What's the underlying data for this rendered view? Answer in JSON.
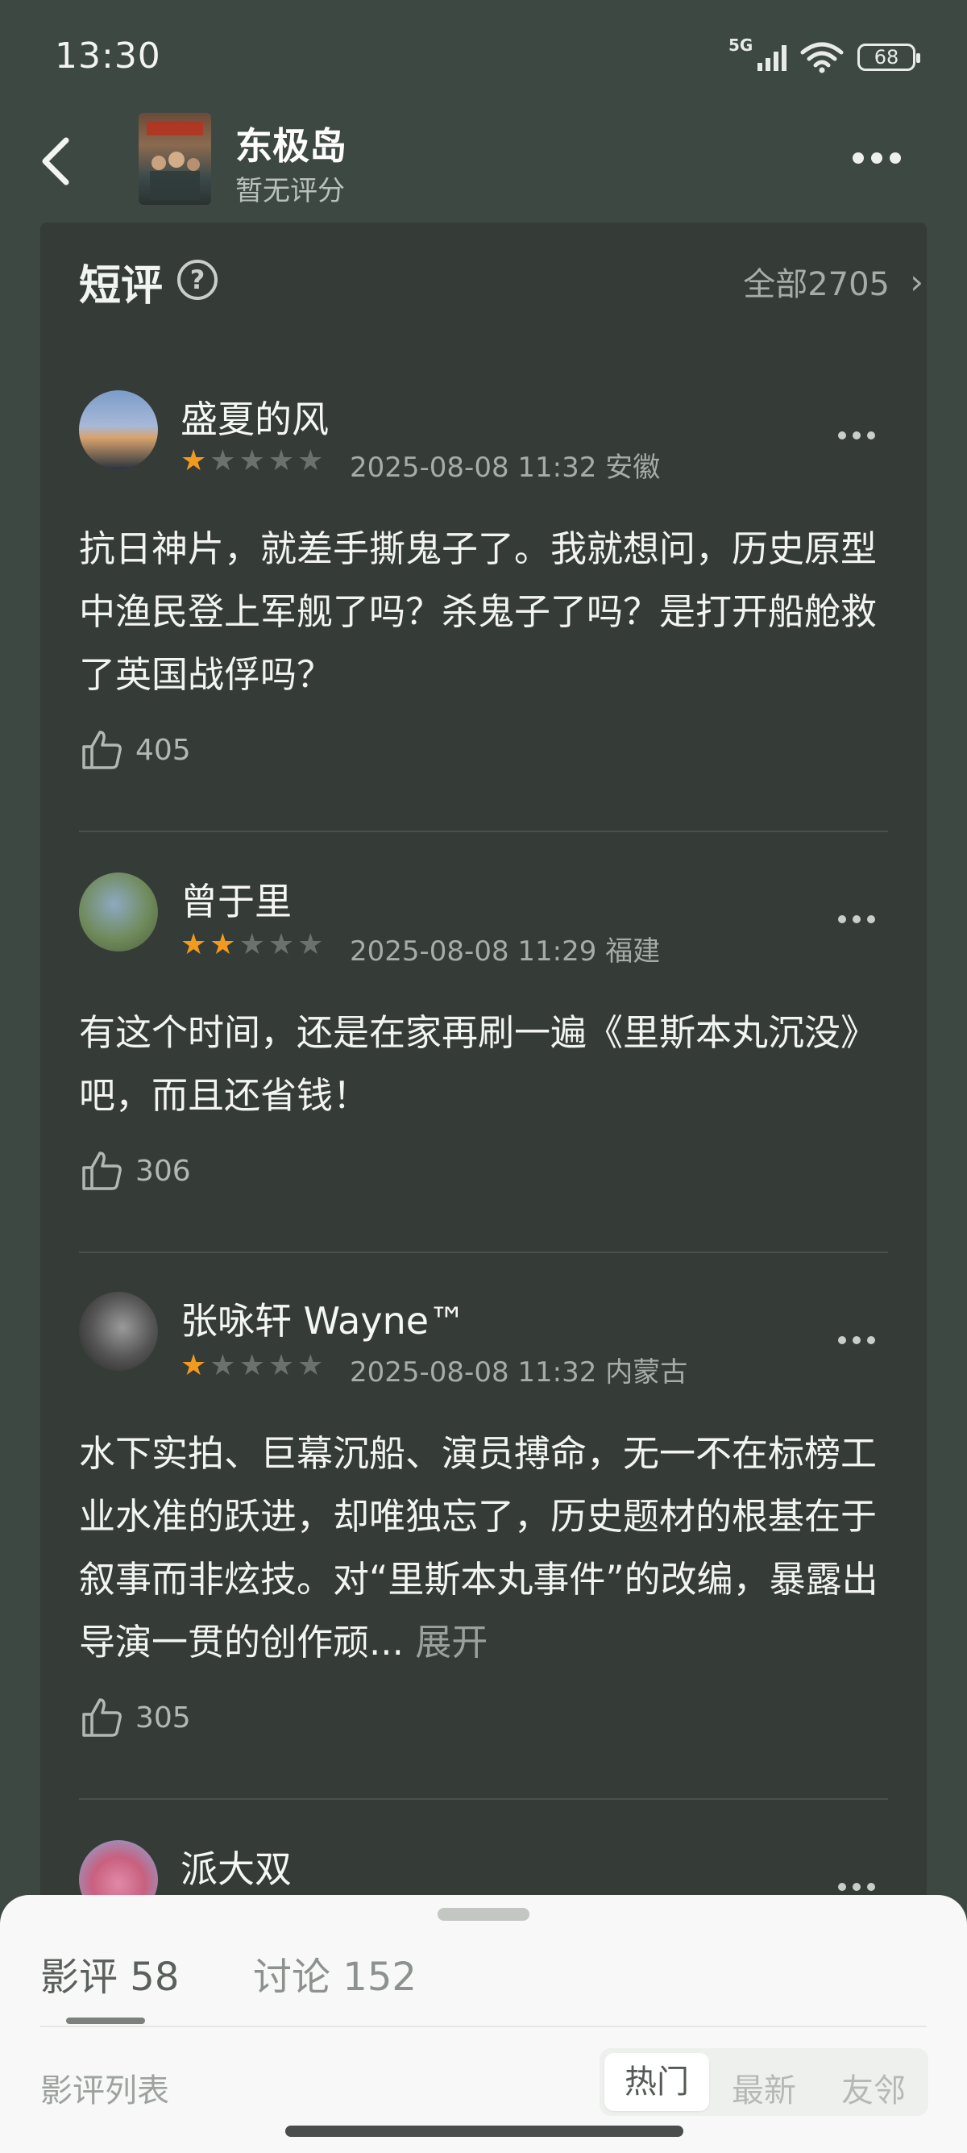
{
  "status_bar": {
    "time": "13:30",
    "network": "5G",
    "battery": "68"
  },
  "header": {
    "title": "东极岛",
    "rating": "暂无评分"
  },
  "section": {
    "title": "短评",
    "all_label": "全部2705"
  },
  "reviews": [
    {
      "user": "盛夏的风",
      "stars": 1,
      "datetime": "2025-08-08 11:32",
      "location": "安徽",
      "text": "抗日神片，就差手撕鬼子了。我就想问，历史原型中渔民登上军舰了吗？杀鬼子了吗？是打开船舱救了英国战俘吗？",
      "likes": "405"
    },
    {
      "user": "曾于里",
      "stars": 2,
      "datetime": "2025-08-08 11:29",
      "location": "福建",
      "text": "有这个时间，还是在家再刷一遍《里斯本丸沉没》吧，而且还省钱！",
      "likes": "306"
    },
    {
      "user": "张咏轩 Wayne™",
      "stars": 1,
      "datetime": "2025-08-08 11:32",
      "location": "内蒙古",
      "text": "水下实拍、巨幕沉船、演员搏命，无一不在标榜工业水准的跃进，却唯独忘了，历史题材的根基在于叙事而非炫技。对“里斯本丸事件”的改编，暴露出导演一贯的创作顽...",
      "expand": "展开",
      "likes": "305"
    },
    {
      "user": "派大双"
    }
  ],
  "sheet": {
    "tabs": [
      {
        "label": "影评",
        "count": "58"
      },
      {
        "label": "讨论",
        "count": "152"
      }
    ],
    "list_label": "影评列表",
    "sort_options": [
      "热门",
      "最新",
      "友邻"
    ]
  },
  "colors": {
    "star": "#f29a1f",
    "background": "#3e4842",
    "card": "#353b37"
  }
}
